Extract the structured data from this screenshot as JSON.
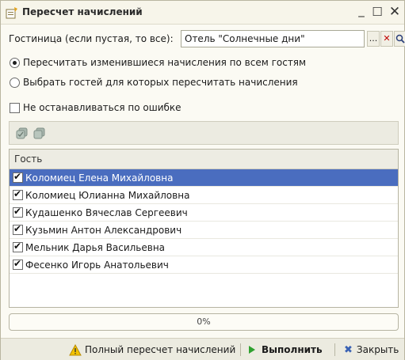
{
  "window": {
    "title": "Пересчет начислений",
    "minimize": "_",
    "maximize": "☐",
    "close": "✕"
  },
  "hotel": {
    "label": "Гостиница (если пустая, то все):",
    "value": "Отель \"Солнечные дни\"",
    "btn_select": "...",
    "btn_clear": "✕",
    "btn_open": "🔍"
  },
  "options": {
    "recalc_all": "Пересчитать изменившиеся начисления по всем гостям",
    "select_guests": "Выбрать гостей для которых пересчитать начисления",
    "selected_option": "recalc_all",
    "continue_on_error": "Не останавливаться по ошибке",
    "continue_on_error_checked": false
  },
  "toolbar": {
    "icons": [
      "check-all-icon",
      "uncheck-all-icon"
    ]
  },
  "guests": {
    "header": "Гость",
    "rows": [
      {
        "name": "Коломиец Елена Михайловна",
        "checked": true,
        "selected": true
      },
      {
        "name": "Коломиец Юлианна Михайловна",
        "checked": true,
        "selected": false
      },
      {
        "name": "Кудашенко Вячеслав Сергеевич",
        "checked": true,
        "selected": false
      },
      {
        "name": "Кузьмин  Антон Александрович",
        "checked": true,
        "selected": false
      },
      {
        "name": "Мельник Дарья Васильевна",
        "checked": true,
        "selected": false
      },
      {
        "name": "Фесенко Игорь Анатольевич",
        "checked": true,
        "selected": false
      }
    ]
  },
  "progress": {
    "text": "0%",
    "value": 0
  },
  "actions": {
    "full_recalc": "Полный пересчет начислений",
    "run": "Выполнить",
    "close": "Закрыть"
  },
  "colors": {
    "selection": "#4a6dbf",
    "run_icon": "#2fa12f",
    "warning_icon": "#f2c200"
  }
}
